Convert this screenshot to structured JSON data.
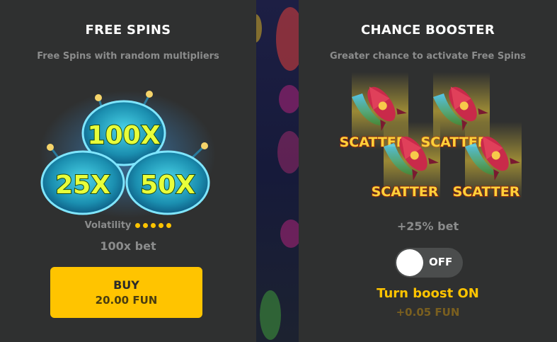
{
  "free_spins": {
    "title": "FREE SPINS",
    "subtitle": "Free Spins with random multipliers",
    "multipliers": [
      "100X",
      "25X",
      "50X"
    ],
    "volatility_label": "Volatility",
    "volatility_level": 5,
    "volatility_max": 5,
    "cost_label": "100x bet",
    "buy_label": "BUY",
    "buy_price": "20.00 FUN",
    "accent": "#ffc400"
  },
  "chance_booster": {
    "title": "CHANCE BOOSTER",
    "subtitle": "Greater chance to activate Free Spins",
    "scatter_label": "SCATTER",
    "bet_increase": "+25% bet",
    "toggle_state": "OFF",
    "cta_label": "Turn boost ON",
    "cta_cost": "+0.05 FUN"
  },
  "colors": {
    "panel_bg": "#2f3030",
    "accent_yellow": "#ffc400",
    "muted_text": "#8b8c8c",
    "toggle_bg": "#4b4d4d"
  }
}
